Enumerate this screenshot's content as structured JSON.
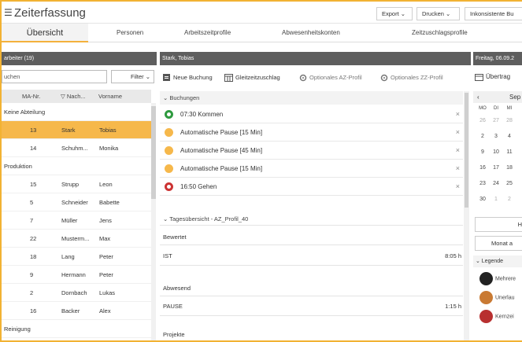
{
  "app": {
    "title": "Zeiterfassung"
  },
  "toolbar": {
    "export": "Export ⌄",
    "print": "Drucken ⌄",
    "inconsistent": "Inkonsistente Bu"
  },
  "tabs": [
    "Übersicht",
    "Personen",
    "Arbeitszeitprofile",
    "Abwesenheitskonten",
    "Zeitzuschlagsprofile"
  ],
  "employees": {
    "header": "arbeiter (19)",
    "search_placeholder": "uchen",
    "filter_label": "Filter ⌄",
    "columns": [
      "MA-Nr.",
      "▽ Nach...",
      "Vorname"
    ],
    "rows": [
      {
        "type": "group",
        "label": "Keine Abteilung"
      },
      {
        "type": "person",
        "nr": "13",
        "last": "Stark",
        "first": "Tobias",
        "selected": true
      },
      {
        "type": "person",
        "nr": "14",
        "last": "Schuhm...",
        "first": "Monika"
      },
      {
        "type": "group",
        "label": "Produktion"
      },
      {
        "type": "person",
        "nr": "15",
        "last": "Strupp",
        "first": "Leon"
      },
      {
        "type": "person",
        "nr": "5",
        "last": "Schneider",
        "first": "Babette"
      },
      {
        "type": "person",
        "nr": "7",
        "last": "Müller",
        "first": "Jens"
      },
      {
        "type": "person",
        "nr": "22",
        "last": "Musterm...",
        "first": "Max"
      },
      {
        "type": "person",
        "nr": "18",
        "last": "Lang",
        "first": "Peter"
      },
      {
        "type": "person",
        "nr": "9",
        "last": "Hermann",
        "first": "Peter"
      },
      {
        "type": "person",
        "nr": "2",
        "last": "Dornbach",
        "first": "Lukas"
      },
      {
        "type": "person",
        "nr": "16",
        "last": "Backer",
        "first": "Alex"
      },
      {
        "type": "group",
        "label": "Reinigung"
      }
    ]
  },
  "detail": {
    "person_header": "Stark, Tobias",
    "actions": {
      "new_booking": "Neue Buchung",
      "flextime": "Gleitzeitzuschlag",
      "opt_az": "Optionales AZ-Profil",
      "opt_zz": "Optionales ZZ-Profil"
    },
    "bookings_title": "⌄  Buchungen",
    "bookings": [
      {
        "kind": "green",
        "text": "07:30    Kommen"
      },
      {
        "kind": "orange",
        "text": "Automatische Pause [15 Min]"
      },
      {
        "kind": "orange",
        "text": "Automatische Pause [45 Min]"
      },
      {
        "kind": "orange",
        "text": "Automatische Pause [15 Min]"
      },
      {
        "kind": "red",
        "text": "16:50    Gehen"
      }
    ],
    "day_title": "⌄  Tagesübersicht - AZ_Profil_40",
    "rated_label": "Bewertet",
    "ist_label": "IST",
    "ist_value": "8:05 h",
    "absent_label": "Abwesend",
    "pause_label": "PAUSE",
    "pause_value": "1:15 h",
    "projects_label": "Projekte"
  },
  "calendar": {
    "date_header": "Freitag, 06.09.2",
    "transfer": "Übertrag",
    "month": "Sep",
    "weekdays": [
      "MO",
      "DI",
      "MI"
    ],
    "weeks": [
      [
        "26",
        "27",
        "28"
      ],
      [
        "2",
        "3",
        "4"
      ],
      [
        "9",
        "10",
        "11"
      ],
      [
        "16",
        "17",
        "18"
      ],
      [
        "23",
        "24",
        "25"
      ],
      [
        "30",
        "1",
        "2"
      ]
    ],
    "today_btn": "H",
    "month_btn": "Monat a",
    "legend_title": "⌄  Legende",
    "legend": [
      {
        "label": "Mehrere",
        "color": "#222222"
      },
      {
        "label": "Unerlau",
        "color": "#c97a33"
      },
      {
        "label": "Kernzei",
        "color": "#b83030"
      }
    ]
  },
  "colors": {
    "accent": "#f6b84b",
    "frame": "#f2b233",
    "darkbar": "#5e5e5e"
  }
}
